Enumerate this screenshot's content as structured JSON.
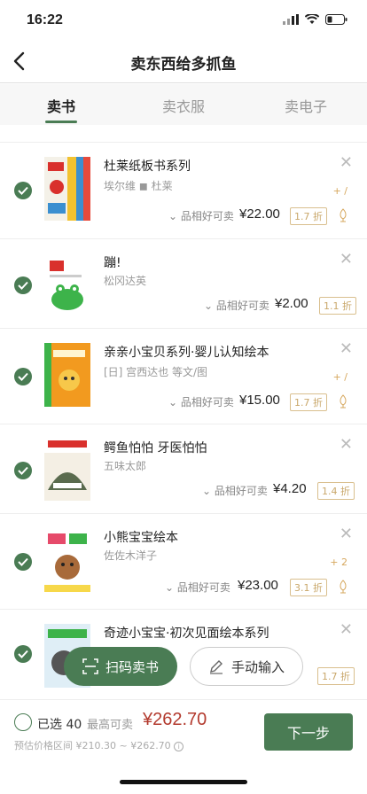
{
  "status": {
    "time": "16:22"
  },
  "nav": {
    "title": "卖东西给多抓鱼"
  },
  "tabs": [
    {
      "label": "卖书"
    },
    {
      "label": "卖衣服"
    },
    {
      "label": "卖电子"
    }
  ],
  "books": [
    {
      "title": "杜莱纸板书系列",
      "author": "埃尔维 ◼ 杜莱",
      "condition": "品相好可卖",
      "price": "¥22.00",
      "discount": "1.7 折",
      "tip": "+ /"
    },
    {
      "title": "蹦!",
      "author": "松冈达英",
      "condition": "品相好可卖",
      "price": "¥2.00",
      "discount": "1.1 折",
      "tip": ""
    },
    {
      "title": "亲亲小宝贝系列·婴儿认知绘本",
      "author": "[日] 宫西达也 等文/图",
      "condition": "品相好可卖",
      "price": "¥15.00",
      "discount": "1.7 折",
      "tip": "+ /"
    },
    {
      "title": "鳄鱼怕怕 牙医怕怕",
      "author": "五味太郎",
      "condition": "品相好可卖",
      "price": "¥4.20",
      "discount": "1.4 折",
      "tip": ""
    },
    {
      "title": "小熊宝宝绘本",
      "author": "佐佐木洋子",
      "condition": "品相好可卖",
      "price": "¥23.00",
      "discount": "3.1 折",
      "tip": "+ 2"
    },
    {
      "title": "奇迹小宝宝·初次见面绘本系列",
      "author": "",
      "condition": "",
      "price": "",
      "discount": "1.7 折",
      "tip": ""
    }
  ],
  "fab": {
    "scan": "扫码卖书",
    "manual": "手动输入"
  },
  "footer": {
    "selected": "已选 40",
    "max_label": "最高可卖",
    "max_value": "¥262.70",
    "range": "预估价格区间 ¥210.30 ~ ¥262.70",
    "next": "下一步"
  },
  "colors": {
    "accent": "#4a7c54",
    "price_red": "#b33a2e",
    "discount_gold": "#c9a76a"
  }
}
